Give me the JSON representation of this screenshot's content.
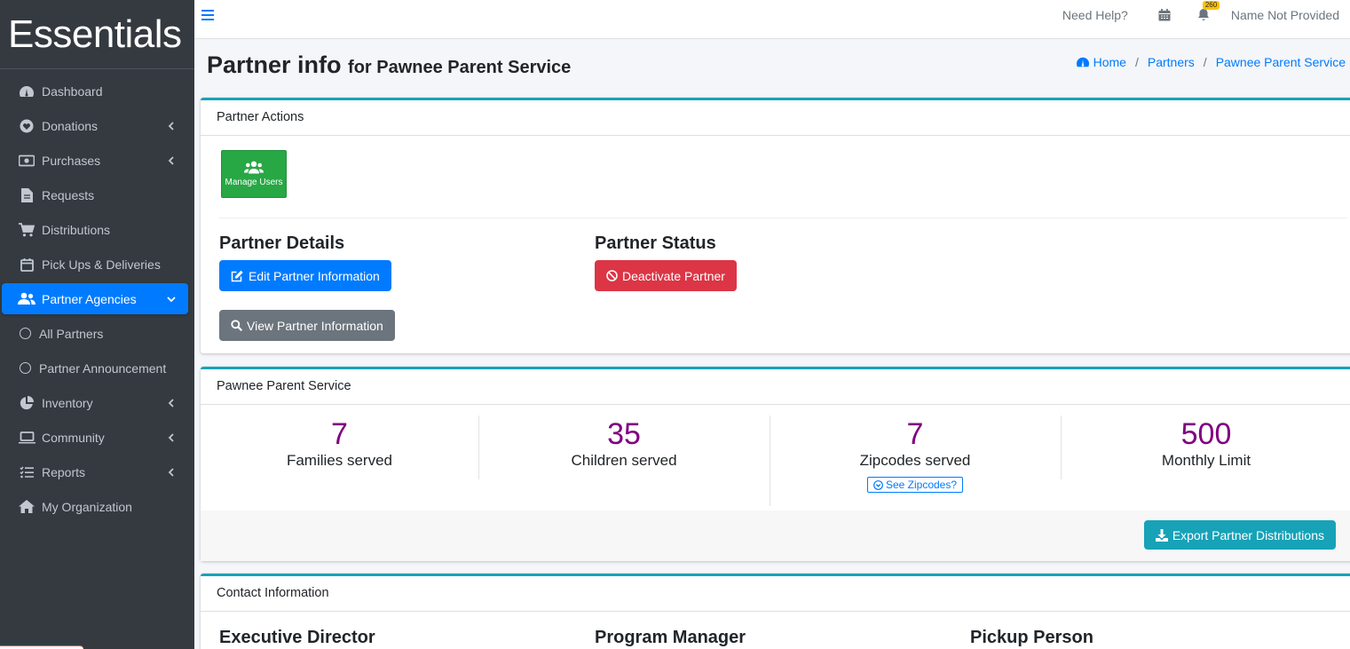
{
  "brand": "Essentials",
  "sidebar": {
    "items": [
      {
        "label": "Dashboard",
        "icon": "dashboard-icon"
      },
      {
        "label": "Donations",
        "icon": "heart-icon"
      },
      {
        "label": "Purchases",
        "icon": "money-icon"
      },
      {
        "label": "Requests",
        "icon": "file-icon"
      },
      {
        "label": "Distributions",
        "icon": "cart-icon"
      },
      {
        "label": "Pick Ups & Deliveries",
        "icon": "calendar-icon"
      },
      {
        "label": "Partner Agencies",
        "icon": "users-icon"
      },
      {
        "label": "All Partners",
        "icon": "circle-icon"
      },
      {
        "label": "Partner Announcement",
        "icon": "circle-icon"
      },
      {
        "label": "Inventory",
        "icon": "pie-chart-icon"
      },
      {
        "label": "Community",
        "icon": "laptop-icon"
      },
      {
        "label": "Reports",
        "icon": "list-icon"
      },
      {
        "label": "My Organization",
        "icon": "home-icon"
      }
    ]
  },
  "topbar": {
    "help": "Need Help?",
    "notification_count": "260",
    "user": "Name Not Provided"
  },
  "header": {
    "title": "Partner info",
    "subtitle": "for Pawnee Parent Service",
    "breadcrumb": [
      "Home",
      "Partners",
      "Pawnee Parent Service"
    ]
  },
  "actions_card": {
    "title": "Partner Actions",
    "manage_users": "Manage Users",
    "details_heading": "Partner Details",
    "status_heading": "Partner Status",
    "edit_button": "Edit Partner Information",
    "view_button": "View Partner Information",
    "deactivate_button": "Deactivate Partner"
  },
  "summary_card": {
    "title": "Pawnee Parent Service",
    "stats": [
      {
        "value": "7",
        "label": "Families served"
      },
      {
        "value": "35",
        "label": "Children served"
      },
      {
        "value": "7",
        "label": "Zipcodes served"
      },
      {
        "value": "500",
        "label": "Monthly Limit"
      }
    ],
    "zip_button": "See Zipcodes?",
    "export_button": "Export Partner Distributions"
  },
  "contact_card": {
    "title": "Contact Information",
    "columns": [
      "Executive Director",
      "Program Manager",
      "Pickup Person"
    ]
  },
  "colors": {
    "sidebar_bg": "#343a40",
    "active_nav": "#007bff",
    "stat_number": "#800080",
    "card_accent": "#17a2b8"
  }
}
